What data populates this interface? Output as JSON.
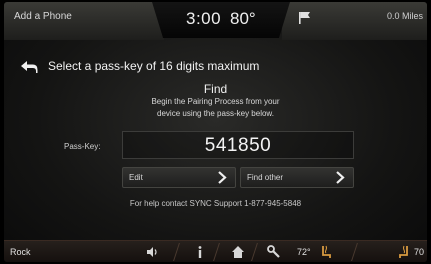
{
  "status_bar": {
    "title": "Add a Phone",
    "time": "3:00",
    "temperature": "80°",
    "range": "0.0 Miles",
    "flag_icon": "flag-icon"
  },
  "header": {
    "instruction": "Select a pass-key of 16 digits maximum",
    "back_icon": "back-arrow-icon"
  },
  "find": {
    "title": "Find",
    "line1": "Begin the Pairing Process from your",
    "line2": "device using the pass-key below."
  },
  "passkey": {
    "label": "Pass-Key:",
    "value": "541850"
  },
  "buttons": {
    "edit_label": "Edit",
    "find_other_label": "Find other"
  },
  "help": {
    "text": "For help contact SYNC Support 1-877-945-5848"
  },
  "bottom_bar": {
    "source": "Rock",
    "temp_left": "72°",
    "temp_right": "70",
    "icons": [
      "speaker-icon",
      "info-icon",
      "home-icon",
      "wrench-icon",
      "seat-heat-icon",
      "seat-heat-right-icon"
    ]
  },
  "colors": {
    "background": "#141413",
    "text": "#e8e8e8",
    "bottom_bar": "#1e1814"
  }
}
